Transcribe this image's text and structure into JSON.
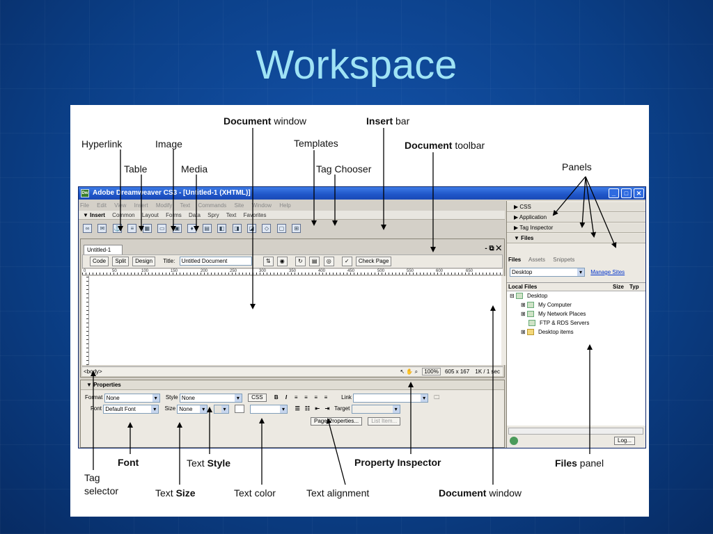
{
  "slide": {
    "title": "Workspace"
  },
  "callouts": {
    "hyperlink": "Hyperlink",
    "image": "Image",
    "table": "Table",
    "media": "Media",
    "document_window_top_b": "Document",
    "document_window_top_r": " window",
    "insert_bar_b": "Insert",
    "insert_bar_r": " bar",
    "templates": "Templates",
    "tag_chooser": "Tag Chooser",
    "document_toolbar_b": "Document",
    "document_toolbar_r": " toolbar",
    "panels": "Panels",
    "font": "Font",
    "text_style_r": "Text ",
    "text_style_b": "Style",
    "tag_selector_1": "Tag",
    "tag_selector_2": "selector",
    "text_size_r": "Text ",
    "text_size_b": "Size",
    "text_color": "Text color",
    "text_alignment": "Text alignment",
    "property_inspector": "Property Inspector",
    "files_panel_b": "Files",
    "files_panel_r": " panel",
    "document_window_bottom_b": "Document",
    "document_window_bottom_r": " window"
  },
  "app": {
    "title": "Adobe Dreamweaver CS3 - [Untitled-1 (XHTML)]",
    "logo": "Dw",
    "menus": [
      "File",
      "Edit",
      "View",
      "Insert",
      "Modify",
      "Text",
      "Commands",
      "Site",
      "Window",
      "Help"
    ],
    "insert_head": "▼ Insert",
    "insert_tabs": [
      "Common",
      "Layout",
      "Forms",
      "Data",
      "Spry",
      "Text",
      "Favorites"
    ],
    "doc_tab": "Untitled-1",
    "doc_controls": "- ⧉ ✕",
    "toolbar": {
      "code": "Code",
      "split": "Split",
      "design": "Design",
      "title_label": "Title:",
      "title_value": "Untitled Document",
      "check_page": "Check Page"
    },
    "ruler_ticks": [
      "0",
      "50",
      "100",
      "150",
      "200",
      "250",
      "300",
      "350",
      "400",
      "450",
      "500",
      "550",
      "600",
      "650"
    ],
    "status": {
      "tag": "<body>",
      "zoom": "100%",
      "size": "605 x 167",
      "download": "1K / 1 sec"
    },
    "properties": {
      "head": "▼ Properties",
      "format_label": "Format",
      "format_value": "None",
      "style_label": "Style",
      "style_value": "None",
      "css_button": "CSS",
      "link_label": "Link",
      "font_label": "Font",
      "font_value": "Default Font",
      "size_label": "Size",
      "size_value": "None",
      "target_label": "Target",
      "page_properties": "Page Properties...",
      "list_item": "List Item..."
    },
    "panels": {
      "css": "▶ CSS",
      "application": "▶ Application",
      "tag_inspector": "▶ Tag Inspector",
      "files": "▼ Files",
      "files_tabs": [
        "Files",
        "Assets",
        "Snippets"
      ],
      "site": "Desktop",
      "manage_sites": "Manage Sites",
      "local_files": "Local Files",
      "size_col": "Size",
      "type_col": "Typ",
      "items": [
        "Desktop",
        "My Computer",
        "My Network Places",
        "FTP & RDS Servers",
        "Desktop items"
      ],
      "log_button": "Log..."
    }
  },
  "colors": {
    "background": "#0b3f87",
    "title": "#9fe3f5",
    "titlebar": "#1f55c8"
  }
}
